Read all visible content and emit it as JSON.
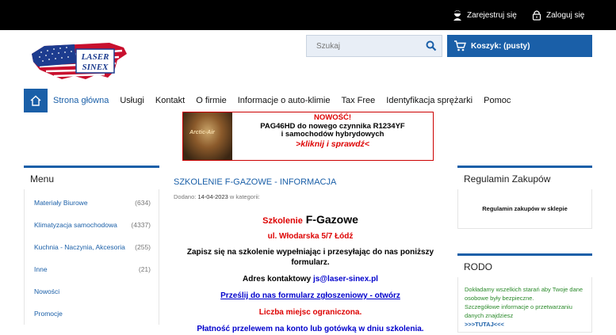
{
  "topbar": {
    "register_label": "Zarejestruj się",
    "login_label": "Zaloguj się"
  },
  "logo": {
    "line1": "LASER",
    "line2": "SINEX"
  },
  "search": {
    "placeholder": "Szukaj",
    "value": "Szukaj"
  },
  "cart": {
    "label": "Koszyk: (pusty)"
  },
  "nav": {
    "items": [
      {
        "label": "Strona główna"
      },
      {
        "label": "Usługi"
      },
      {
        "label": "Kontakt"
      },
      {
        "label": "O firmie"
      },
      {
        "label": "Informacje o auto-klimie"
      },
      {
        "label": "Tax Free"
      },
      {
        "label": "Identyfikacja sprężarki"
      },
      {
        "label": "Pomoc"
      }
    ]
  },
  "banner": {
    "can_text": "Arctic-Air",
    "line1": "NOWOŚĆ!",
    "line2": "PAG46HD do nowego czynnika R1234YF",
    "line3": "i samochodów hybrydowych",
    "line4": ">kliknij i sprawdź<"
  },
  "menu": {
    "title": "Menu",
    "items": [
      {
        "label": "Materiały Biurowe",
        "count": "(634)"
      },
      {
        "label": "Klimatyzacja samochodowa",
        "count": "(4337)"
      },
      {
        "label": "Kuchnia - Naczynia, Akcesoria",
        "count": "(255)"
      },
      {
        "label": "Inne",
        "count": "(21)"
      },
      {
        "label": "Nowości",
        "count": ""
      },
      {
        "label": "Promocje",
        "count": ""
      }
    ]
  },
  "article": {
    "title": "SZKOLENIE F-GAZOWE - INFORMACJA",
    "meta_prefix": "Dodano:",
    "date": "14-04-2023",
    "meta_suffix": "w kategorii:",
    "heading_red": "Szkolenie",
    "heading_black": "F-Gazowe",
    "address": "ul. Włodarska 5/7 Łódź",
    "p1": "Zapisz się na szkolenie wypełniając i przesyłając do nas poniższy formularz.",
    "contact_label": "Adres kontaktowy",
    "contact_email": "js@laser-sinex.pl",
    "form_link": "Prześlij do nas formularz zgłoszeniowy - otwórz",
    "limited": "Liczba miejsc ograniczona.",
    "payment": "Płatność przelewem na konto lub gotówką w dniu szkolenia."
  },
  "regulamin": {
    "title": "Regulamin Zakupów",
    "link": "Regulamin zakupów w sklepie"
  },
  "rodo": {
    "title": "RODO",
    "text1": "Dokładamy wszelkich starań aby Twoje dane osobowe były bezpieczne.",
    "text2": "Szczegółowe informacje o przetwarzaniu danych znajdziesz",
    "link": ">>>TUTAJ<<<"
  },
  "colors": {
    "accent": "#1a5fa8",
    "topbar": "#000000",
    "red": "#dd0000"
  }
}
